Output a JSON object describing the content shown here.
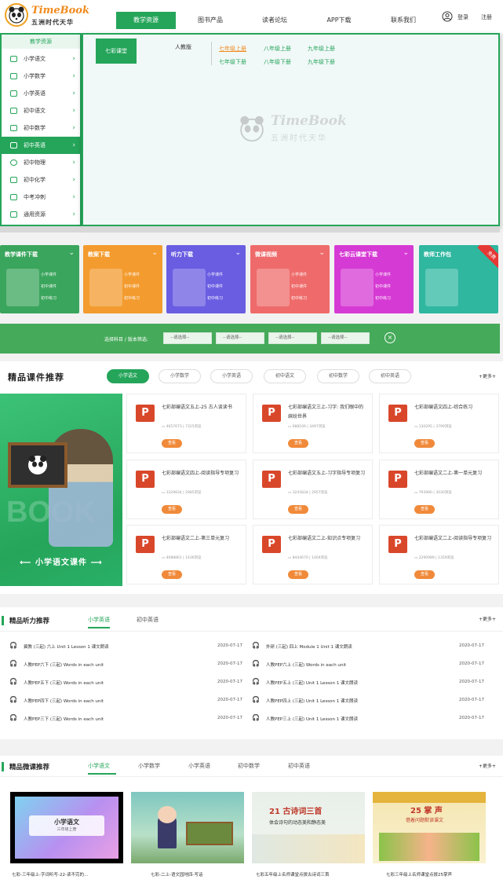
{
  "header": {
    "brand": "TimeBook",
    "brand_sub": "五洲时代天华",
    "nav": [
      "教学资源",
      "图书产品",
      "读者论坛",
      "APP下载",
      "联系我们"
    ],
    "login": "登录",
    "register": "注册"
  },
  "sidebar": {
    "title": "教学资源",
    "items": [
      "小学语文",
      "小学数学",
      "小学英语",
      "初中语文",
      "初中数学",
      "初中英语",
      "初中物理",
      "初中化学",
      "中考冲刺",
      "通用资源"
    ]
  },
  "panel": {
    "tag": "七彩课堂",
    "publisher": "人教版",
    "grades": [
      "七年级上册",
      "八年级上册",
      "九年级上册",
      "七年级下册",
      "八年级下册",
      "九年级下册"
    ],
    "watermark_brand": "TimeBook",
    "watermark_sub": "五洲时代天华"
  },
  "categories": [
    {
      "title": "教学课件下载",
      "lines": [
        "小学课件",
        "初中课件",
        "初中练习"
      ],
      "color": "#3aa55c"
    },
    {
      "title": "教案下载",
      "lines": [
        "小学课件",
        "初中课件",
        "初中练习"
      ],
      "color": "#f39b2e"
    },
    {
      "title": "听力下载",
      "lines": [
        "小学课件",
        "初中课件",
        "初中练习"
      ],
      "color": "#6a5de2"
    },
    {
      "title": "微课视频",
      "lines": [
        "小学课件",
        "初中课件",
        "初中练习"
      ],
      "color": "#ef6b6b"
    },
    {
      "title": "七彩云课堂下载",
      "lines": [
        "小学课件",
        "初中课件",
        "初中练习"
      ],
      "color": "#d63ad4"
    },
    {
      "title": "教师工作包",
      "lines": [],
      "color": "#2fb7a0",
      "badge": "免费"
    }
  ],
  "filter": {
    "label": "选择科目 / 版本筛选:",
    "placeholders": [
      "--请选择--",
      "--请选择--",
      "--请选择--",
      "--请选择--"
    ]
  },
  "courseware": {
    "title": "精品课件推荐",
    "tabs": [
      "小学语文",
      "小学数学",
      "小学英语",
      "初中语文",
      "初中数学",
      "初中英语"
    ],
    "more": "+更多+",
    "banner_caption": "⟵ 小学语文课件 ⟶",
    "banner_word": "BOOK",
    "download": "查看",
    "cards": [
      {
        "title": "七彩部编语文五上-25 古人谈读书",
        "meta": "4657673 | 7325浏览"
      },
      {
        "title": "七彩部编语文三上-习字: 我们眼中的缤纷世界",
        "meta": "688109 | 3497浏览"
      },
      {
        "title": "七彩部编语文四上-综合练习",
        "meta": "130295 | 3799浏览"
      },
      {
        "title": "七彩部编语文四上-阅读指导专项复习",
        "meta": "3329834 | 2985浏览"
      },
      {
        "title": "七彩部编语文五上-习字指导专项复习",
        "meta": "3245834 | 2957浏览"
      },
      {
        "title": "七彩部编语文二上-第一单元复习",
        "meta": "793980 | 3030浏览"
      },
      {
        "title": "七彩部编语文二上-第三单元复习",
        "meta": "4088861 | 1436浏览"
      },
      {
        "title": "七彩部编语文二上-知识点专项复习",
        "meta": "8444670 | 1404浏览"
      },
      {
        "title": "七彩部编语文二上-阅读指导专项复习",
        "meta": "2290989 | 1359浏览"
      }
    ]
  },
  "listening": {
    "title": "精品听力推荐",
    "tabs": [
      "小学英语",
      "初中英语"
    ],
    "more": "+更多+",
    "rows": [
      {
        "title": "冀教 (三起) 六上 Unit 1 Lesson 1 课文朗读",
        "date": "2020-07-17"
      },
      {
        "title": "外研 (三起) 四上 Module 1 Unit 1 课文朗读",
        "date": "2020-07-17"
      },
      {
        "title": "人教PEP六下 (三起) Words in each unit",
        "date": "2020-07-17"
      },
      {
        "title": "人教PEP六上 (三起) Words in each unit",
        "date": "2020-07-17"
      },
      {
        "title": "人教PEP五下 (三起) Words in each unit",
        "date": "2020-07-17"
      },
      {
        "title": "人教PEP五上 (三起) Unit 1 Lesson 1 课文朗读",
        "date": "2020-07-17"
      },
      {
        "title": "人教PEP四下 (三起) Words in each unit",
        "date": "2020-07-17"
      },
      {
        "title": "人教PEP四上 (三起) Unit 1 Lesson 1 课文朗读",
        "date": "2020-07-17"
      },
      {
        "title": "人教PEP三下 (三起) Words in each unit",
        "date": "2020-07-17"
      },
      {
        "title": "人教PEP三上 (三起) Unit 1 Lesson 1 课文朗读",
        "date": "2020-07-17"
      }
    ]
  },
  "micro": {
    "title": "精品微课推荐",
    "tabs": [
      "小学语文",
      "小学数学",
      "小学英语",
      "初中数学",
      "初中英语"
    ],
    "more": "+更多+",
    "videos": [
      {
        "caption": "七彩-三年级上-字词听写-22-读不完的...",
        "art_title": "小学语文",
        "art_sub": "三年级上册"
      },
      {
        "caption": "七彩-二上-语文园地四-写话",
        "art_title": "",
        "art_sub": ""
      },
      {
        "caption": "七彩五年级上名师课堂点拨古诗词三首",
        "art_title": "21 古诗词三首",
        "art_sub": "体会诗句的动态美和静态美"
      },
      {
        "caption": "七彩三年级上名师课堂点拨25掌声",
        "art_title": "25 掌 声",
        "art_sub": "借着问题默读课文"
      }
    ]
  }
}
